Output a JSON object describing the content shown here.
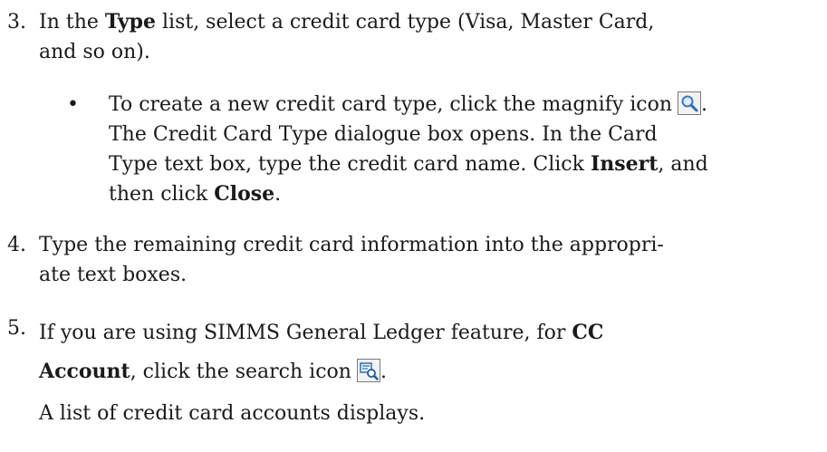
{
  "step3": {
    "num": "3.",
    "line1_pre": "In the ",
    "line1_bold": "Type",
    "line1_post": " list, select a credit card type (Visa, Master Card,",
    "line2": "and so on)."
  },
  "bullet1": {
    "marker": "•",
    "line1": "To create a new credit card type, click the magnify icon",
    "line1_end": ".",
    "line2": "The Credit Card Type dialogue box opens. In the Card",
    "line3_pre": "Type text box, type the credit card name. Click ",
    "line3_bold": "Insert",
    "line3_post": ", and",
    "line4_pre": "then click ",
    "line4_bold": "Close",
    "line4_post": "."
  },
  "step4": {
    "num": "4.",
    "line1": "Type the remaining credit card information into the appropri-",
    "line2": "ate text boxes."
  },
  "step5": {
    "num": "5.",
    "line1_pre": "If you are using SIMMS General Ledger feature, for ",
    "line1_bold": "CC",
    "line2_bold": "Account",
    "line2_post": ", click the search icon",
    "line2_end": "."
  },
  "result": {
    "text": "A list of credit card accounts displays."
  },
  "icons": {
    "magnify": "magnify-icon",
    "search": "search-icon",
    "magnify_color": "#3a78c8",
    "search_color": "#2e6fb8"
  }
}
